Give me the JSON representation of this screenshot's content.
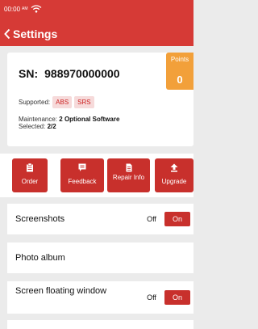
{
  "status_bar": {
    "time": "00:00",
    "ampm": "AM"
  },
  "header": {
    "title": "Settings"
  },
  "device": {
    "sn_label": "SN:",
    "sn_value": "988970000000",
    "points_label": "Points",
    "points_value": "0",
    "supported_label": "Supported:",
    "supported_badges": [
      "ABS",
      "SRS"
    ],
    "maintenance_label": "Maintenance:",
    "maintenance_value": "2 Optional Software",
    "selected_label": "Selected:",
    "selected_value": "2/2"
  },
  "actions": [
    {
      "label": "Order",
      "icon": "clipboard-icon"
    },
    {
      "label": "Feedback",
      "icon": "message-icon"
    },
    {
      "label": "Repair Info",
      "icon": "document-icon"
    },
    {
      "label": "Upgrade",
      "icon": "upload-icon"
    }
  ],
  "settings": {
    "screenshots": {
      "label": "Screenshots",
      "off": "Off",
      "on": "On"
    },
    "photo_album": {
      "label": "Photo album"
    },
    "floating_window": {
      "label": "Screen floating window",
      "off": "Off",
      "on": "On"
    }
  },
  "colors": {
    "primary": "#d63a36",
    "button": "#c8302c",
    "points": "#f2a03a",
    "badge_bg": "#f6dada"
  }
}
